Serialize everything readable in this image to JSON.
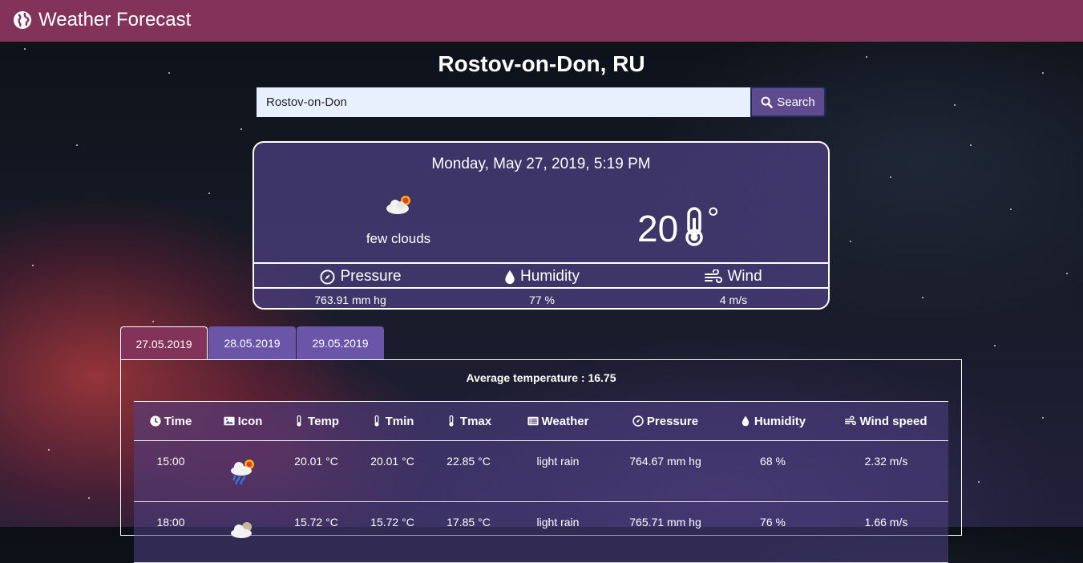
{
  "app": {
    "title": "Weather Forecast"
  },
  "location": {
    "city": "Rostov-on-Don, RU"
  },
  "search": {
    "value": "Rostov-on-Don",
    "button_label": "Search"
  },
  "current": {
    "datetime": "Monday, May 27, 2019, 5:19 PM",
    "condition": "few clouds",
    "condition_icon": "partly-cloudy-icon",
    "temperature": "20",
    "degree_symbol": "°",
    "metrics": [
      {
        "label": "Pressure",
        "icon": "compass-icon",
        "value": "763.91 mm hg"
      },
      {
        "label": "Humidity",
        "icon": "droplet-icon",
        "value": "77 %"
      },
      {
        "label": "Wind",
        "icon": "wind-icon",
        "value": "4 m/s"
      }
    ]
  },
  "tabs": [
    {
      "label": "27.05.2019",
      "active": true
    },
    {
      "label": "28.05.2019",
      "active": false
    },
    {
      "label": "29.05.2019",
      "active": false
    }
  ],
  "forecast": {
    "average_label": "Average temperature : 16.75",
    "columns": [
      {
        "label": "Time",
        "icon": "clock-icon"
      },
      {
        "label": "Icon",
        "icon": "image-icon"
      },
      {
        "label": "Temp",
        "icon": "thermometer-icon"
      },
      {
        "label": "Tmin",
        "icon": "thermometer-icon"
      },
      {
        "label": "Tmax",
        "icon": "thermometer-icon"
      },
      {
        "label": "Weather",
        "icon": "list-icon"
      },
      {
        "label": "Pressure",
        "icon": "compass-icon"
      },
      {
        "label": "Humidity",
        "icon": "droplet-icon"
      },
      {
        "label": "Wind speed",
        "icon": "wind-icon"
      }
    ],
    "rows": [
      {
        "time": "15:00",
        "icon": "rain-sun-icon",
        "temp": "20.01 °C",
        "tmin": "20.01 °C",
        "tmax": "22.85 °C",
        "weather": "light rain",
        "pressure": "764.67 mm hg",
        "humidity": "68 %",
        "wind": "2.32 m/s"
      },
      {
        "time": "18:00",
        "icon": "rain-night-icon",
        "temp": "15.72 °C",
        "tmin": "15.72 °C",
        "tmax": "17.85 °C",
        "weather": "light rain",
        "pressure": "765.71 mm hg",
        "humidity": "76 %",
        "wind": "1.66 m/s"
      }
    ]
  },
  "colors": {
    "navbar": "#83335a",
    "accent": "#6a55a8",
    "search_button": "#5f4a8f"
  }
}
